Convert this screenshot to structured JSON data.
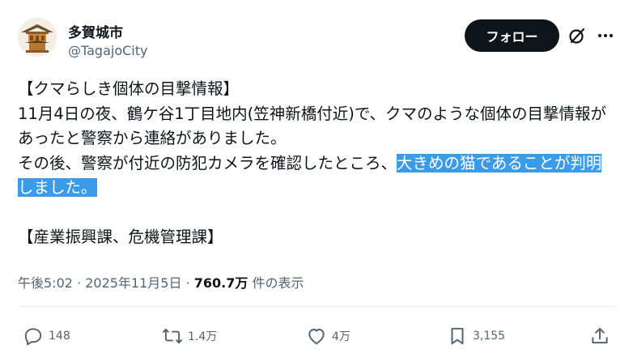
{
  "header": {
    "display_name": "多賀城市",
    "handle": "@TagajoCity",
    "follow_label": "フォロー",
    "icons": [
      "grok-icon",
      "more-icon"
    ]
  },
  "tweet": {
    "line1": "【クマらしき個体の目撃情報】",
    "line2": "11月4日の夜、鶴ケ谷1丁目地内(笠神新橋付近)で、クマのような個体の目撃情報があったと警察から連絡がありました。",
    "line3_plain": "その後、警察が付近の防犯カメラを確認したところ、",
    "line3_highlight": "大きめの猫であることが判明しました。",
    "footer": "【産業振興課、危機管理課】"
  },
  "meta": {
    "time": "午後5:02",
    "sep1": " · ",
    "date": "2025年11月5日",
    "sep2": " · ",
    "views": "760.7万",
    "views_label": " 件の表示"
  },
  "actions": {
    "replies": "148",
    "reposts": "1.4万",
    "likes": "4万",
    "bookmarks": "3,155"
  },
  "colors": {
    "highlight": "#3c9be8",
    "secondary_text": "#536471",
    "primary_text": "#0f1419"
  }
}
